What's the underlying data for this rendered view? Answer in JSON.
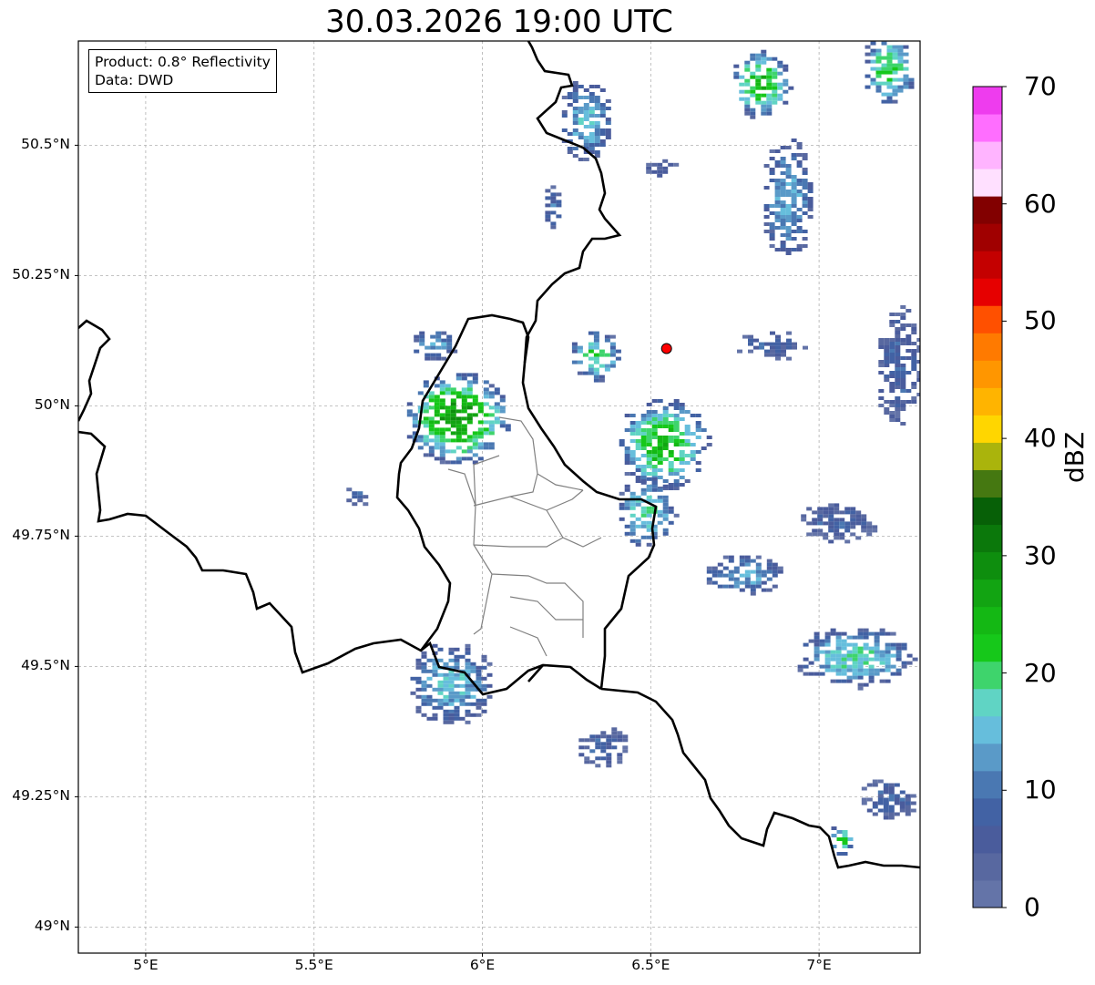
{
  "title": "30.03.2026 19:00 UTC",
  "info": {
    "product": "Product: 0.8° Reflectivity",
    "data": "Data: DWD"
  },
  "axes": {
    "lon_labels": [
      "5°E",
      "5.5°E",
      "6°E",
      "6.5°E",
      "7°E"
    ],
    "lat_labels": [
      "50.5°N",
      "50.25°N",
      "50°N",
      "49.75°N",
      "49.5°N",
      "49.25°N",
      "49°N"
    ],
    "lon_values": [
      5.0,
      5.5,
      6.0,
      6.5,
      7.0
    ],
    "lat_values": [
      50.5,
      50.25,
      50.0,
      49.75,
      49.5,
      49.25,
      49.0
    ],
    "lon_range": [
      4.8,
      7.3
    ],
    "lat_range": [
      48.95,
      50.7
    ],
    "grid": true
  },
  "colorbar": {
    "label": "dBZ",
    "min": 0,
    "max": 70,
    "ticks": [
      "0",
      "10",
      "20",
      "30",
      "40",
      "50",
      "60",
      "70"
    ],
    "colors": [
      "#6474a8",
      "#5868a0",
      "#4a5c9c",
      "#4262a4",
      "#4a78b2",
      "#5a9ac8",
      "#66bedc",
      "#60d4c4",
      "#3ed46c",
      "#16c81a",
      "#14b814",
      "#12a412",
      "#0e8e0e",
      "#0b780b",
      "#076007",
      "#457811",
      "#aab40c",
      "#ffd600",
      "#ffb400",
      "#ff9600",
      "#ff7a00",
      "#ff5000",
      "#e60000",
      "#c40000",
      "#a00000",
      "#820000",
      "#ffe0ff",
      "#ffb4ff",
      "#ff6eff",
      "#ee3cee"
    ]
  },
  "marker": {
    "name": "radar-site",
    "lon": 6.547,
    "lat": 50.11,
    "color": "#ff0000"
  },
  "echoes": [
    {
      "lon": 5.92,
      "lat": 49.98,
      "rx": 0.16,
      "ry": 0.09,
      "dbz": 28
    },
    {
      "lon": 5.85,
      "lat": 50.12,
      "rx": 0.07,
      "ry": 0.03,
      "dbz": 14
    },
    {
      "lon": 6.33,
      "lat": 50.1,
      "rx": 0.08,
      "ry": 0.05,
      "dbz": 20
    },
    {
      "lon": 6.53,
      "lat": 49.93,
      "rx": 0.14,
      "ry": 0.09,
      "dbz": 24
    },
    {
      "lon": 6.48,
      "lat": 49.8,
      "rx": 0.09,
      "ry": 0.07,
      "dbz": 18
    },
    {
      "lon": 5.9,
      "lat": 49.47,
      "rx": 0.13,
      "ry": 0.08,
      "dbz": 16
    },
    {
      "lon": 6.35,
      "lat": 49.35,
      "rx": 0.08,
      "ry": 0.04,
      "dbz": 8
    },
    {
      "lon": 6.77,
      "lat": 49.68,
      "rx": 0.12,
      "ry": 0.04,
      "dbz": 14
    },
    {
      "lon": 7.1,
      "lat": 49.52,
      "rx": 0.18,
      "ry": 0.06,
      "dbz": 18
    },
    {
      "lon": 7.05,
      "lat": 49.78,
      "rx": 0.12,
      "ry": 0.04,
      "dbz": 8
    },
    {
      "lon": 6.9,
      "lat": 50.4,
      "rx": 0.08,
      "ry": 0.12,
      "dbz": 14
    },
    {
      "lon": 6.82,
      "lat": 50.62,
      "rx": 0.09,
      "ry": 0.07,
      "dbz": 24
    },
    {
      "lon": 7.2,
      "lat": 50.65,
      "rx": 0.08,
      "ry": 0.07,
      "dbz": 22
    },
    {
      "lon": 6.3,
      "lat": 50.55,
      "rx": 0.08,
      "ry": 0.08,
      "dbz": 16
    },
    {
      "lon": 6.2,
      "lat": 50.38,
      "rx": 0.03,
      "ry": 0.05,
      "dbz": 10
    },
    {
      "lon": 6.85,
      "lat": 50.12,
      "rx": 0.11,
      "ry": 0.03,
      "dbz": 8
    },
    {
      "lon": 7.23,
      "lat": 50.08,
      "rx": 0.07,
      "ry": 0.12,
      "dbz": 8
    },
    {
      "lon": 7.2,
      "lat": 49.25,
      "rx": 0.09,
      "ry": 0.04,
      "dbz": 8
    },
    {
      "lon": 7.06,
      "lat": 49.17,
      "rx": 0.04,
      "ry": 0.03,
      "dbz": 22
    },
    {
      "lon": 5.62,
      "lat": 49.83,
      "rx": 0.04,
      "ry": 0.02,
      "dbz": 8
    },
    {
      "lon": 6.52,
      "lat": 50.46,
      "rx": 0.05,
      "ry": 0.02,
      "dbz": 6
    }
  ]
}
